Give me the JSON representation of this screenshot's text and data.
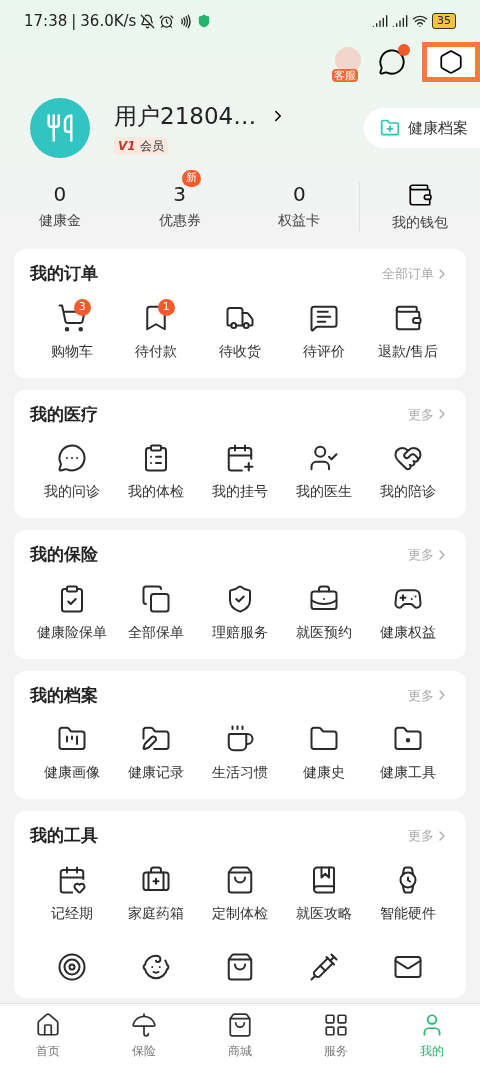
{
  "status_bar": {
    "time": "17:38",
    "separator": "|",
    "speed": "36.0K/s",
    "battery": "35"
  },
  "header": {
    "service_label": "客服",
    "message_badge": true,
    "settings_highlighted": true
  },
  "profile": {
    "name": "用户21804…",
    "level": "V1",
    "member_label": "会员",
    "health_record_button": "健康档案"
  },
  "stats": [
    {
      "value": "0",
      "label": "健康金"
    },
    {
      "value": "3",
      "label": "优惠券",
      "badge": "新"
    },
    {
      "value": "0",
      "label": "权益卡"
    }
  ],
  "wallet": {
    "label": "我的钱包"
  },
  "sections": [
    {
      "title": "我的订单",
      "more": "全部订单",
      "items": [
        {
          "label": "购物车",
          "badge": "3"
        },
        {
          "label": "待付款",
          "badge": "1"
        },
        {
          "label": "待收货"
        },
        {
          "label": "待评价"
        },
        {
          "label": "退款/售后"
        }
      ]
    },
    {
      "title": "我的医疗",
      "more": "更多",
      "items": [
        {
          "label": "我的问诊"
        },
        {
          "label": "我的体检"
        },
        {
          "label": "我的挂号"
        },
        {
          "label": "我的医生"
        },
        {
          "label": "我的陪诊"
        }
      ]
    },
    {
      "title": "我的保险",
      "more": "更多",
      "items": [
        {
          "label": "健康险保单"
        },
        {
          "label": "全部保单"
        },
        {
          "label": "理赔服务"
        },
        {
          "label": "就医预约"
        },
        {
          "label": "健康权益"
        }
      ]
    },
    {
      "title": "我的档案",
      "more": "更多",
      "items": [
        {
          "label": "健康画像"
        },
        {
          "label": "健康记录"
        },
        {
          "label": "生活习惯"
        },
        {
          "label": "健康史"
        },
        {
          "label": "健康工具"
        }
      ]
    },
    {
      "title": "我的工具",
      "more": "更多",
      "items": [
        {
          "label": "记经期"
        },
        {
          "label": "家庭药箱"
        },
        {
          "label": "定制体检"
        },
        {
          "label": "就医攻略"
        },
        {
          "label": "智能硬件"
        },
        {
          "kind": "icon"
        },
        {
          "kind": "icon"
        },
        {
          "kind": "icon"
        },
        {
          "kind": "icon"
        },
        {
          "kind": "icon"
        }
      ]
    }
  ],
  "bottom_nav": [
    {
      "label": "首页",
      "selected": false
    },
    {
      "label": "保险",
      "selected": false
    },
    {
      "label": "商城",
      "selected": false
    },
    {
      "label": "服务",
      "selected": false
    },
    {
      "label": "我的",
      "selected": true
    }
  ]
}
